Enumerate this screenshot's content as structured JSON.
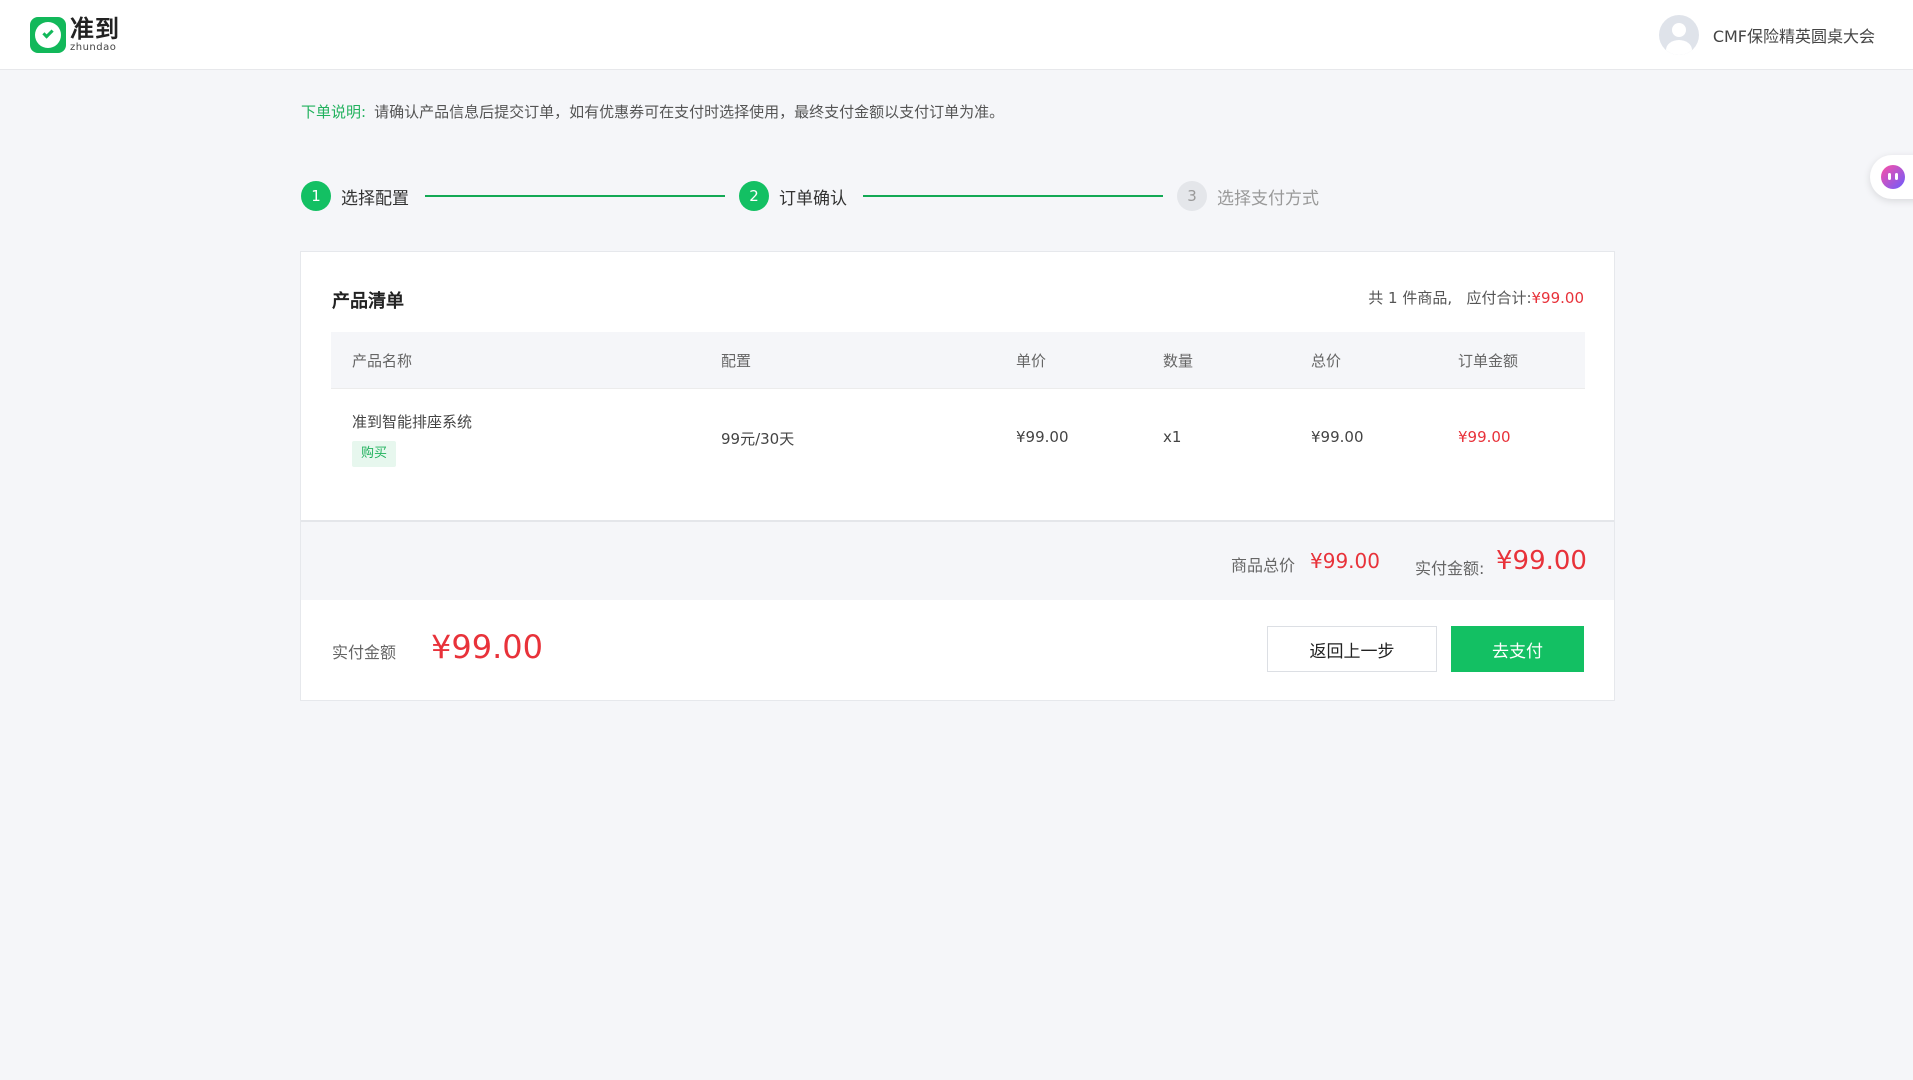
{
  "header": {
    "logo_cn": "准到",
    "logo_en": "zhundao",
    "user_name": "CMF保险精英圆桌大会"
  },
  "notice": {
    "label": "下单说明:",
    "text": "请确认产品信息后提交订单，如有优惠券可在支付时选择使用，最终支付金额以支付订单为准。"
  },
  "steps": [
    {
      "num": "1",
      "label": "选择配置"
    },
    {
      "num": "2",
      "label": "订单确认"
    },
    {
      "num": "3",
      "label": "选择支付方式"
    }
  ],
  "card": {
    "title": "产品清单",
    "summary": {
      "count_text": "共 1 件商品,",
      "due_label": "应付合计:",
      "due_amount": "¥99.00"
    },
    "columns": [
      "产品名称",
      "配置",
      "单价",
      "数量",
      "总价",
      "订单金额"
    ],
    "rows": [
      {
        "name": "准到智能排座系统",
        "tag": "购买",
        "config": "99元/30天",
        "unit_price": "¥99.00",
        "qty": "x1",
        "total": "¥99.00",
        "order_amount": "¥99.00"
      }
    ],
    "totals": {
      "goods_label": "商品总价",
      "goods_amount": "¥99.00",
      "paid_label": "实付金额:",
      "paid_amount": "¥99.00"
    }
  },
  "bottom": {
    "pay_label": "实付金额",
    "pay_amount": "¥99.00",
    "back_label": "返回上一步",
    "pay_button_label": "去支付"
  },
  "colors": {
    "brand_green": "#13c063",
    "price_red": "#e8323a"
  }
}
